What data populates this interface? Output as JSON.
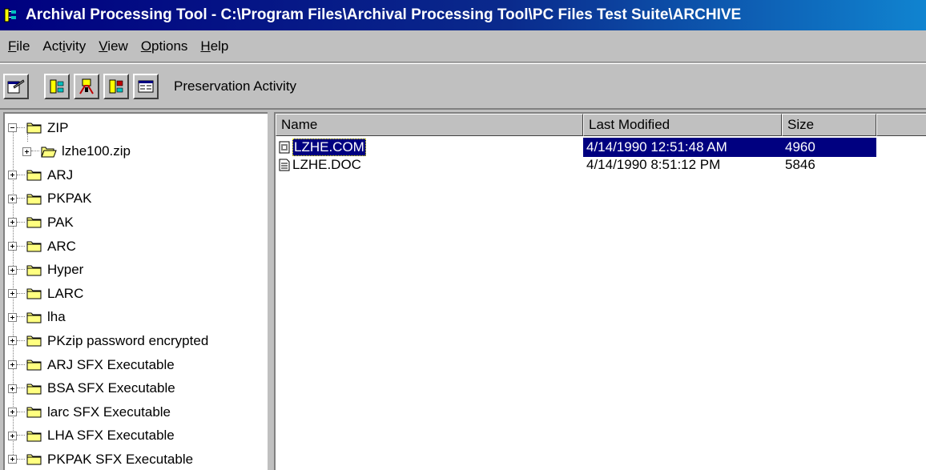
{
  "window": {
    "title": "Archival Processing Tool - C:\\Program Files\\Archival Processing Tool\\PC Files Test Suite\\ARCHIVE"
  },
  "menu": [
    {
      "label": "File",
      "key": "F",
      "rest": "ile"
    },
    {
      "label": "Activity",
      "pre": "Act",
      "key": "i",
      "rest": "vity"
    },
    {
      "label": "View",
      "key": "V",
      "rest": "iew"
    },
    {
      "label": "Options",
      "key": "O",
      "rest": "ptions"
    },
    {
      "label": "Help",
      "key": "H",
      "rest": "elp"
    }
  ],
  "toolbar": {
    "buttons": [
      "properties-icon",
      "preserve-activity-icon",
      "tool-activity-icon",
      "extract-activity-icon",
      "view-details-icon"
    ],
    "activity_label": "Preservation Activity"
  },
  "tree": {
    "items": [
      {
        "label": "ZIP",
        "level": 0,
        "expanded": true,
        "open_folder": false
      },
      {
        "label": "lzhe100.zip",
        "level": 1,
        "expanded": false,
        "open_folder": true
      },
      {
        "label": "ARJ",
        "level": 0,
        "expanded": false
      },
      {
        "label": "PKPAK",
        "level": 0,
        "expanded": false
      },
      {
        "label": "PAK",
        "level": 0,
        "expanded": false
      },
      {
        "label": "ARC",
        "level": 0,
        "expanded": false
      },
      {
        "label": "Hyper",
        "level": 0,
        "expanded": false
      },
      {
        "label": "LARC",
        "level": 0,
        "expanded": false
      },
      {
        "label": "lha",
        "level": 0,
        "expanded": false
      },
      {
        "label": "PKzip password encrypted",
        "level": 0,
        "expanded": false
      },
      {
        "label": "ARJ SFX Executable",
        "level": 0,
        "expanded": false
      },
      {
        "label": "BSA SFX Executable",
        "level": 0,
        "expanded": false
      },
      {
        "label": "larc SFX Executable",
        "level": 0,
        "expanded": false
      },
      {
        "label": "LHA SFX Executable",
        "level": 0,
        "expanded": false
      },
      {
        "label": "PKPAK SFX Executable",
        "level": 0,
        "expanded": false
      }
    ]
  },
  "list": {
    "columns": [
      "Name",
      "Last Modified",
      "Size"
    ],
    "rows": [
      {
        "name": "LZHE.COM",
        "modified": "4/14/1990 12:51:48 AM",
        "size": "4960",
        "selected": true,
        "icon": "executable-file-icon"
      },
      {
        "name": "LZHE.DOC",
        "modified": "4/14/1990 8:51:12 PM",
        "size": "5846",
        "selected": false,
        "icon": "document-file-icon"
      }
    ]
  },
  "colors": {
    "title_bar": "#000080",
    "selection": "#000080",
    "folder": "#ffff80",
    "face": "#c0c0c0"
  }
}
